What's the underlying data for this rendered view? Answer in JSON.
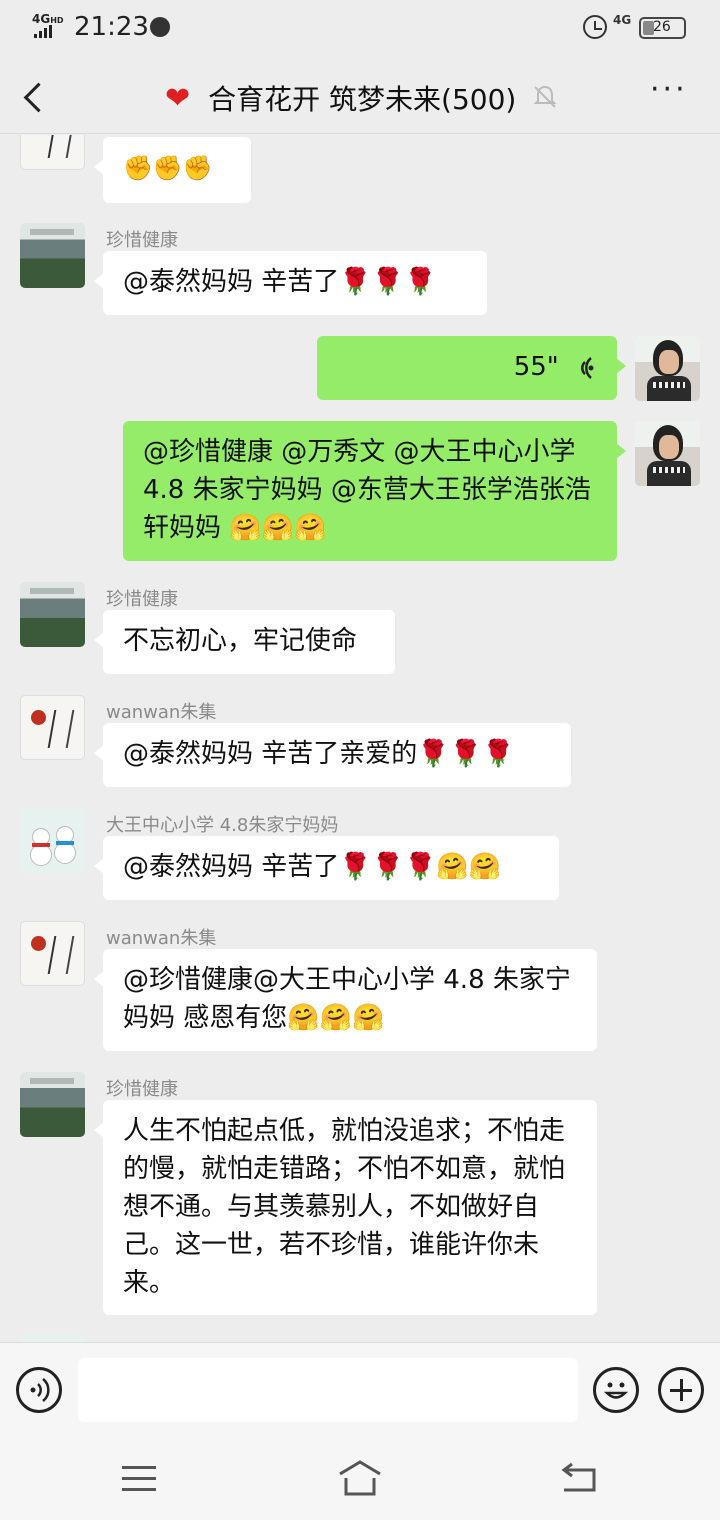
{
  "status_bar": {
    "network": "4G",
    "network_sup": "HD",
    "time": "21:23",
    "cell": "4G",
    "battery": "26"
  },
  "header": {
    "title": "合育花开 筑梦未来(500)",
    "heart_icon": "heart",
    "muted_icon": "bell-muted"
  },
  "messages": [
    {
      "side": "left",
      "sender": "",
      "avatar": "calligraphy",
      "text": "✊✊✊"
    },
    {
      "side": "left",
      "sender": "珍惜健康",
      "avatar": "school",
      "text": "@泰然妈妈  辛苦了🌹🌹🌹"
    },
    {
      "side": "right",
      "type": "voice",
      "duration": "55\"",
      "avatar": "me"
    },
    {
      "side": "right",
      "avatar": "me",
      "text": "@珍惜健康 @万秀文 @大王中心小学 4.8 朱家宁妈妈 @东营大王张学浩张浩轩妈妈 🤗🤗🤗"
    },
    {
      "side": "left",
      "sender": "珍惜健康",
      "avatar": "school",
      "text": "不忘初心，牢记使命"
    },
    {
      "side": "left",
      "sender": "wanwan朱集",
      "avatar": "calligraphy",
      "text": "@泰然妈妈  辛苦了亲爱的🌹🌹🌹"
    },
    {
      "side": "left",
      "sender": "大王中心小学 4.8朱家宁妈妈",
      "avatar": "snowman",
      "text": "@泰然妈妈  辛苦了🌹🌹🌹🤗🤗"
    },
    {
      "side": "left",
      "sender": "wanwan朱集",
      "avatar": "calligraphy",
      "text": "@珍惜健康@大王中心小学 4.8 朱家宁妈妈   感恩有您🤗🤗🤗"
    },
    {
      "side": "left",
      "sender": "珍惜健康",
      "avatar": "school",
      "text": "人生不怕起点低，就怕没追求；不怕走的慢，就怕走错路；不怕不如意，就怕想不通。与其羡慕别人，不如做好自己。这一世，若不珍惜，谁能许你未来。"
    }
  ],
  "input": {
    "value": "",
    "placeholder": ""
  },
  "colors": {
    "background": "#ededed",
    "right_bubble": "#95ec69",
    "left_bubble": "#ffffff"
  }
}
